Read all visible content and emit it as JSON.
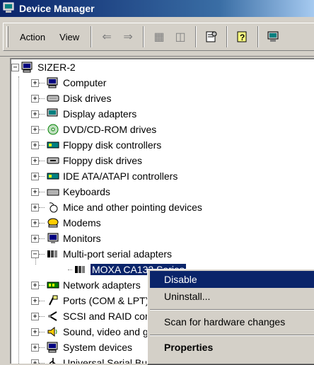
{
  "window": {
    "title": "Device Manager"
  },
  "menu": {
    "action": "Action",
    "view": "View"
  },
  "tree": {
    "root": "SIZER-2",
    "items": [
      "Computer",
      "Disk drives",
      "Display adapters",
      "DVD/CD-ROM drives",
      "Floppy disk controllers",
      "Floppy disk drives",
      "IDE ATA/ATAPI controllers",
      "Keyboards",
      "Mice and other pointing devices",
      "Modems",
      "Monitors",
      "Multi-port serial adapters",
      "MOXA CA132 Series",
      "Network adapters",
      "Ports (COM & LPT)",
      "SCSI and RAID controllers",
      "Sound, video and game controllers",
      "System devices",
      "Universal Serial Bus controllers"
    ]
  },
  "context_menu": {
    "disable": "Disable",
    "uninstall": "Uninstall...",
    "scan": "Scan for hardware changes",
    "properties": "Properties"
  }
}
